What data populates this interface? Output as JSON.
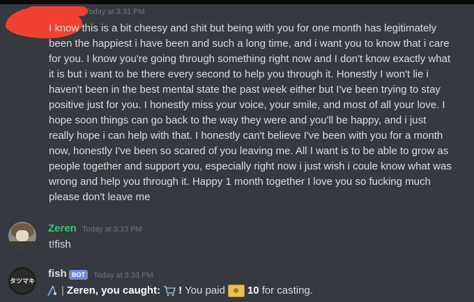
{
  "messages": [
    {
      "author": "",
      "timestamp": "Today at 3:31 PM",
      "text": "I know this is a bit cheesy and shit but being with you for one month has legitimately been the happiest i have been and such a long time, and i want you to know that i care for you. I know you're going through something right now and I don't know exactly what it is but i want to be there every second to help you through it. Honestly I won't lie i haven't been in the best mental state the past week either but I've been trying to stay positive just for you. I honestly miss your voice, your smile, and most of all your love. I hope soon things can go back to the way they were and you'll be happy, and i just really hope i can help with that. I honestly can't believe I've been with you for a month now, honestly I've been so scared of you leaving me. All I want is to be able to grow as people together and support you, especially right now i just wish i coule know what was wrong and help you through it. Happy 1 month together I love you so fucking much please don't leave me"
    },
    {
      "author": "Zeren",
      "timestamp": "Today at 3:33 PM",
      "text": "t!fish",
      "name_color": "#2ecc71"
    },
    {
      "author": "fish",
      "badge": "BOT",
      "timestamp": "Today at 3:33 PM",
      "parts": {
        "separator": "|",
        "caught": "Zeren, you caught:",
        "exclaim": "!",
        "paid": "You paid",
        "amount": "10",
        "suffix": "for casting."
      },
      "icons": [
        "fishing-rod-emoji-icon",
        "shopping-cart-emoji-icon",
        "coin-emoji-icon"
      ]
    }
  ],
  "colors": {
    "background": "#36393f",
    "redaction": "#f0402f",
    "bot_badge": "#7289da",
    "username_green": "#2ecc71"
  }
}
